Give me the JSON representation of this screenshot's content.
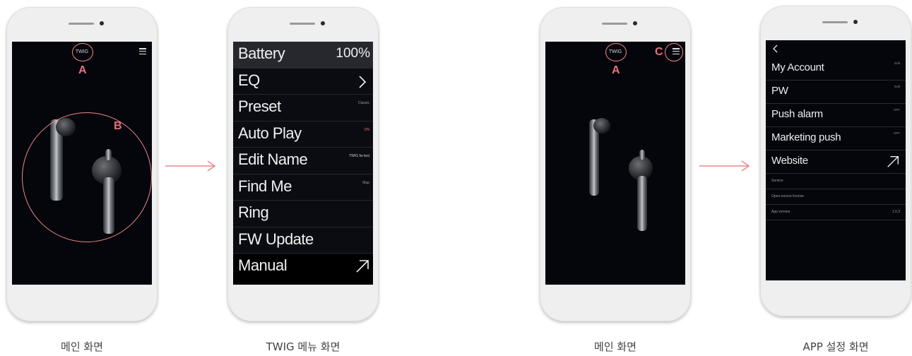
{
  "colors": {
    "annotation": "#ee868a",
    "screen_bg": "#05060c",
    "phone_body": "#efefef"
  },
  "main_screen_1": {
    "brand": "TWIG",
    "labels": {
      "a": "A",
      "b": "B"
    },
    "menu_icon": "hamburger-icon"
  },
  "twig_menu": {
    "items": [
      {
        "label": "Battery",
        "value": "100%"
      },
      {
        "label": "EQ",
        "icon": "chevron-right-icon"
      },
      {
        "label": "Preset",
        "value": "Classic"
      },
      {
        "label": "Auto Play",
        "value": "ON"
      },
      {
        "label": "Edit Name",
        "value": "TWIG fw test"
      },
      {
        "label": "Find Me",
        "value": "Map"
      },
      {
        "label": "Ring",
        "value": ""
      },
      {
        "label": "FW Update",
        "value": ""
      },
      {
        "label": "Manual",
        "icon": "arrow-up-right-icon"
      }
    ]
  },
  "main_screen_2": {
    "brand": "TWIG",
    "labels": {
      "a": "A",
      "c": "C"
    },
    "menu_icon": "hamburger-icon"
  },
  "app_settings": {
    "back_icon": "chevron-left-icon",
    "items": [
      {
        "label": "My Account",
        "value": "Edit"
      },
      {
        "label": "PW",
        "value": "Edit"
      },
      {
        "label": "Push alarm",
        "value": "OFF"
      },
      {
        "label": "Marketing push",
        "value": "OFF"
      },
      {
        "label": "Website",
        "icon": "arrow-up-right-icon"
      }
    ],
    "small_items": [
      {
        "label": "Service",
        "value": ""
      },
      {
        "label": "Open-source license",
        "value": ""
      },
      {
        "label": "App version",
        "value": "1.0.3"
      }
    ]
  },
  "captions": [
    "메인 화면",
    "TWIG 메뉴 화면",
    "메인 화면",
    "APP 설정 화면"
  ]
}
